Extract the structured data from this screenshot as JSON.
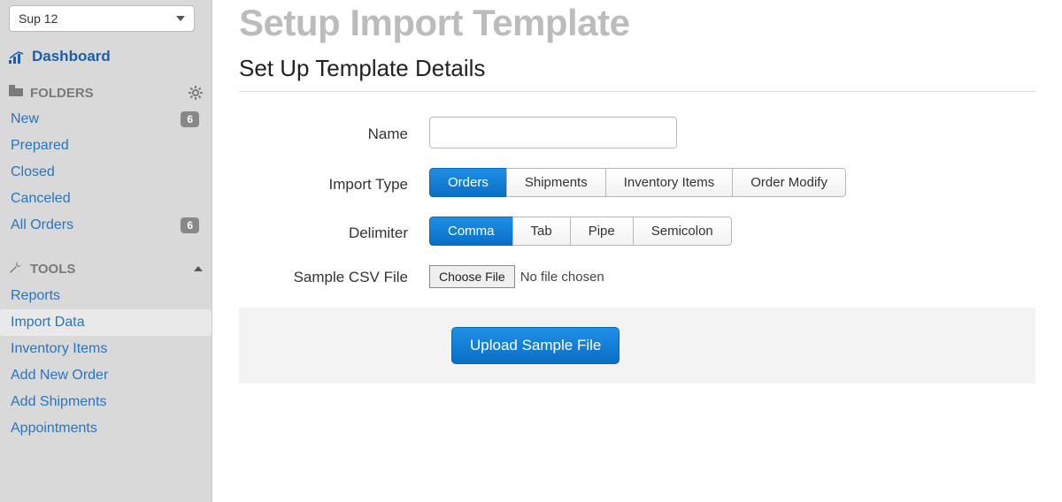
{
  "sidebar": {
    "org_selected": "Sup 12",
    "dashboard_label": "Dashboard",
    "folders_header": "FOLDERS",
    "folders": [
      {
        "label": "New",
        "badge": "6"
      },
      {
        "label": "Prepared",
        "badge": null
      },
      {
        "label": "Closed",
        "badge": null
      },
      {
        "label": "Canceled",
        "badge": null
      },
      {
        "label": "All Orders",
        "badge": "6"
      }
    ],
    "tools_header": "TOOLS",
    "tools": [
      {
        "label": "Reports",
        "active": false
      },
      {
        "label": "Import Data",
        "active": true
      },
      {
        "label": "Inventory Items",
        "active": false
      },
      {
        "label": "Add New Order",
        "active": false
      },
      {
        "label": "Add Shipments",
        "active": false
      },
      {
        "label": "Appointments",
        "active": false
      }
    ]
  },
  "main": {
    "title": "Setup Import Template",
    "section_title": "Set Up Template Details",
    "labels": {
      "name": "Name",
      "import_type": "Import Type",
      "delimiter": "Delimiter",
      "sample_file": "Sample CSV File"
    },
    "name_value": "",
    "import_types": [
      "Orders",
      "Shipments",
      "Inventory Items",
      "Order Modify"
    ],
    "import_type_selected": "Orders",
    "delimiters": [
      "Comma",
      "Tab",
      "Pipe",
      "Semicolon"
    ],
    "delimiter_selected": "Comma",
    "choose_file_label": "Choose File",
    "file_status": "No file chosen",
    "upload_button": "Upload Sample File"
  }
}
